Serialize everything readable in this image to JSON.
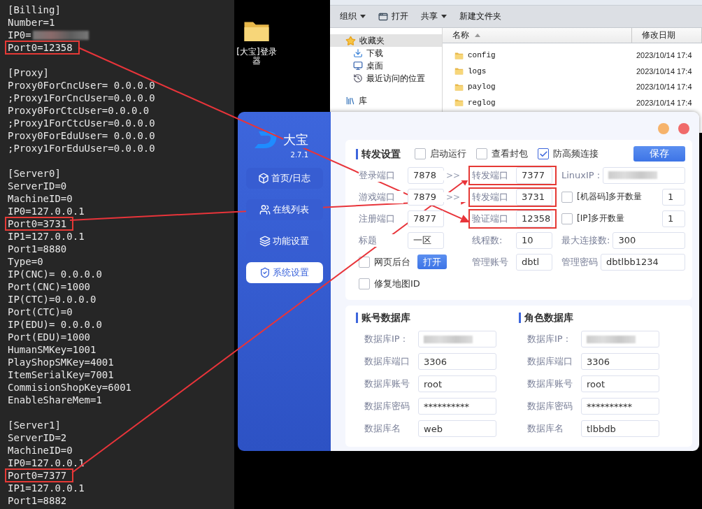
{
  "editor": {
    "sections": [
      {
        "lines": [
          {
            "text": "[Billing]",
            "kind": "plain"
          },
          {
            "text": "Number=1",
            "kind": "plain"
          },
          {
            "text": "IP0=",
            "kind": "redacted"
          },
          {
            "text": "Port0=12358",
            "kind": "boxed"
          }
        ]
      },
      {
        "lines": [
          {
            "text": "[Proxy]",
            "kind": "plain"
          },
          {
            "text": "Proxy0ForCncUser= 0.0.0.0",
            "kind": "plain"
          },
          {
            "text": ";Proxy1ForCncUser=0.0.0.0",
            "kind": "plain"
          },
          {
            "text": "Proxy0ForCtcUser=0.0.0.0",
            "kind": "plain"
          },
          {
            "text": ";Proxy1ForCtcUser=0.0.0.0",
            "kind": "plain"
          },
          {
            "text": "Proxy0ForEduUser= 0.0.0.0",
            "kind": "plain"
          },
          {
            "text": ";Proxy1ForEduUser=0.0.0.0",
            "kind": "plain"
          }
        ]
      },
      {
        "lines": [
          {
            "text": "[Server0]",
            "kind": "plain"
          },
          {
            "text": "ServerID=0",
            "kind": "plain"
          },
          {
            "text": "MachineID=0",
            "kind": "plain"
          },
          {
            "text": "IP0=127.0.0.1",
            "kind": "plain"
          },
          {
            "text": "Port0=3731",
            "kind": "boxed"
          },
          {
            "text": "IP1=127.0.0.1",
            "kind": "plain"
          },
          {
            "text": "Port1=8880",
            "kind": "plain"
          },
          {
            "text": "Type=0",
            "kind": "plain"
          },
          {
            "text": "IP(CNC)= 0.0.0.0",
            "kind": "plain"
          },
          {
            "text": "Port(CNC)=1000",
            "kind": "plain"
          },
          {
            "text": "IP(CTC)=0.0.0.0",
            "kind": "plain"
          },
          {
            "text": "Port(CTC)=0",
            "kind": "plain"
          },
          {
            "text": "IP(EDU)= 0.0.0.0",
            "kind": "plain"
          },
          {
            "text": "Port(EDU)=1000",
            "kind": "plain"
          },
          {
            "text": "HumanSMKey=1001",
            "kind": "plain"
          },
          {
            "text": "PlayShopSMKey=4001",
            "kind": "plain"
          },
          {
            "text": "ItemSerialKey=7001",
            "kind": "plain"
          },
          {
            "text": "CommisionShopKey=6001",
            "kind": "plain"
          },
          {
            "text": "EnableShareMem=1",
            "kind": "plain"
          }
        ]
      },
      {
        "lines": [
          {
            "text": "[Server1]",
            "kind": "plain"
          },
          {
            "text": "ServerID=2",
            "kind": "plain"
          },
          {
            "text": "MachineID=0",
            "kind": "plain"
          },
          {
            "text": "IP0=127.0.0.1",
            "kind": "plain"
          },
          {
            "text": "Port0=7377",
            "kind": "boxed"
          },
          {
            "text": "IP1=127.0.0.1",
            "kind": "plain"
          },
          {
            "text": "Port1=8882",
            "kind": "plain"
          }
        ]
      }
    ]
  },
  "desktop_icon": {
    "label": "[大宝]登录器"
  },
  "explorer": {
    "toolbar": [
      {
        "label": "组织",
        "kind": "menu"
      },
      {
        "label": "打开",
        "kind": "open"
      },
      {
        "label": "共享",
        "kind": "menu"
      },
      {
        "label": "新建文件夹",
        "kind": "plain"
      }
    ],
    "nav": [
      {
        "label": "收藏夹",
        "selected": true,
        "children": [
          {
            "label": "下载",
            "selected": false
          },
          {
            "label": "桌面",
            "selected": false
          },
          {
            "label": "最近访问的位置",
            "selected": false
          }
        ]
      },
      {
        "label": "库",
        "selected": false
      }
    ],
    "columns": [
      {
        "label": "名称",
        "sorted": true
      },
      {
        "label": "修改日期",
        "sorted": false
      }
    ],
    "files": [
      {
        "name": "config",
        "date": "2023/10/14 17:4"
      },
      {
        "name": "logs",
        "date": "2023/10/14 17:4"
      },
      {
        "name": "paylog",
        "date": "2023/10/14 17:4"
      },
      {
        "name": "reglog",
        "date": "2023/10/14 17:4"
      }
    ]
  },
  "app": {
    "brand": "大宝",
    "version": "2.7.1",
    "nav": [
      {
        "label": "首页/日志",
        "selected": false
      },
      {
        "label": "在线列表",
        "selected": false
      },
      {
        "label": "功能设置",
        "selected": false
      },
      {
        "label": "系统设置",
        "selected": true
      }
    ],
    "forward": {
      "title": "转发设置",
      "options": [
        {
          "label": "启动运行",
          "checked": false
        },
        {
          "label": "查看封包",
          "checked": false
        },
        {
          "label": "防高频连接",
          "checked": true
        }
      ],
      "save": "保存",
      "rows": [
        {
          "left": {
            "kind": "field",
            "label": "登录端口",
            "value": "7878"
          },
          "arrow": ">>",
          "mid": {
            "label": "转发端口",
            "value": "7377",
            "boxed": true
          },
          "right": {
            "kind": "blurred",
            "label": "LinuxIP :"
          }
        },
        {
          "left": {
            "kind": "field",
            "label": "游戏端口",
            "value": "7879"
          },
          "arrow": ">>",
          "mid": {
            "label": "转发端口",
            "value": "3731",
            "boxed": true
          },
          "right": {
            "kind": "check",
            "label": "[机器码]多开数量",
            "checked": false,
            "value": "1"
          }
        },
        {
          "left": {
            "kind": "field",
            "label": "注册端口",
            "value": "7877"
          },
          "mid": {
            "label": "验证端口",
            "value": "12358",
            "boxed": true
          },
          "right": {
            "kind": "check",
            "label": "[IP]多开数量",
            "checked": false,
            "value": "1"
          }
        },
        {
          "left": {
            "kind": "field",
            "label": "标题",
            "value": "一区"
          },
          "mid": {
            "label": "线程数:",
            "value": "10",
            "boxed": false
          },
          "right": {
            "kind": "field",
            "label": "最大连接数:",
            "value": "300"
          }
        },
        {
          "left": {
            "kind": "check",
            "label": "网页后台",
            "checked": false,
            "button": "打开"
          },
          "mid": {
            "label": "管理账号",
            "value": "dbtl",
            "boxed": false
          },
          "right": {
            "kind": "field",
            "label": "管理密码",
            "value": "dbtlbb1234"
          }
        },
        {
          "left": {
            "kind": "check",
            "label": "修复地图ID",
            "checked": false
          }
        }
      ]
    },
    "databases": [
      {
        "title": "账号数据库",
        "fields": [
          {
            "label": "数据库IP :",
            "kind": "blurred"
          },
          {
            "label": "数据库端口",
            "kind": "text",
            "value": "3306"
          },
          {
            "label": "数据库账号",
            "kind": "text",
            "value": "root"
          },
          {
            "label": "数据库密码",
            "kind": "text",
            "value": "**********"
          },
          {
            "label": "数据库名",
            "kind": "text",
            "value": "web"
          }
        ]
      },
      {
        "title": "角色数据库",
        "fields": [
          {
            "label": "数据库IP :",
            "kind": "blurred"
          },
          {
            "label": "数据库端口",
            "kind": "text",
            "value": "3306"
          },
          {
            "label": "数据库账号",
            "kind": "text",
            "value": "root"
          },
          {
            "label": "数据库密码",
            "kind": "text",
            "value": "**********"
          },
          {
            "label": "数据库名",
            "kind": "text",
            "value": "tlbbdb"
          }
        ]
      }
    ]
  }
}
